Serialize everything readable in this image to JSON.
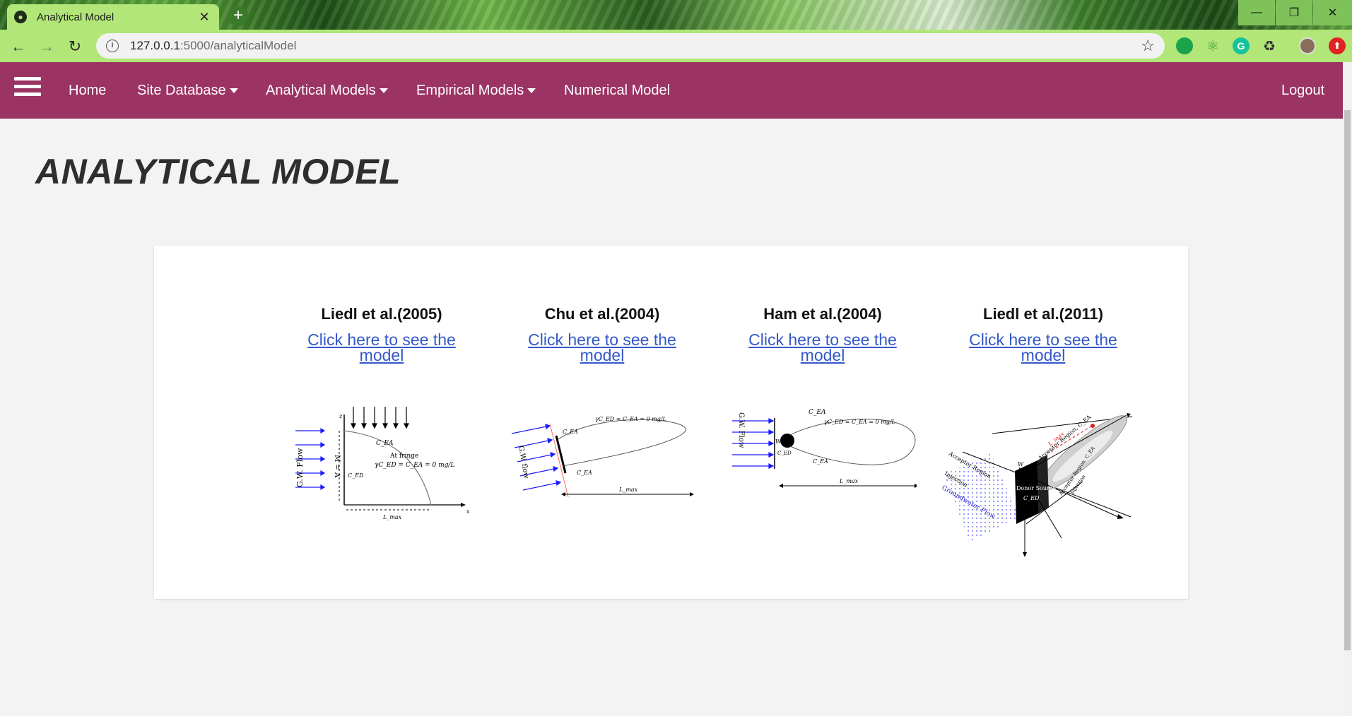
{
  "browser": {
    "tab_title": "Analytical Model",
    "url_host": "127.0.0.1",
    "url_rest": ":5000/analyticalModel"
  },
  "nav": {
    "home": "Home",
    "site_database": "Site Database",
    "analytical_models": "Analytical Models",
    "empirical_models": "Empirical Models",
    "numerical_model": "Numerical Model",
    "logout": "Logout"
  },
  "page": {
    "title": "ANALYTICAL MODEL"
  },
  "models": [
    {
      "name": "Liedl et al.(2005)",
      "link": "Click here to see the model",
      "figure": {
        "flow_label": "G.W. Flow",
        "w_label": "M = A",
        "c_ed": "C_ED",
        "c_ea": "C_EA",
        "fringe": "At fringe",
        "eq": "γC_ED = C_EA = 0 mg/L",
        "lmax": "L_max",
        "axis_z": "z",
        "axis_x": "x"
      }
    },
    {
      "name": "Chu et al.(2004)",
      "link": "Click here to see the model",
      "figure": {
        "flow_label": "G.W. flow",
        "c_ea": "C_EA",
        "eq": "γC_ED = C_EA = 0 mg/L",
        "lmax": "L_max"
      }
    },
    {
      "name": "Ham et al.(2004)",
      "link": "Click here to see the model",
      "figure": {
        "flow_label": "G.W. Flow",
        "c_ea": "C_EA",
        "c_ed": "C_ED",
        "eq": "γC_ED = C_EA = 0 mg/L",
        "lmax": "L_max",
        "w_label": "W"
      }
    },
    {
      "name": "Liedl et al.(2011)",
      "link": "Click here to see the model",
      "figure": {
        "flow_label": "Groundwater Flow",
        "donor": "Donor Source",
        "acceptor_up": "Acceptor Region, C_EA",
        "acceptor_left": "Acceptor Region",
        "injection": "Injection",
        "c_ed": "C_ED",
        "lmax": "L_max",
        "w_label": "W",
        "m_label": "M"
      }
    }
  ],
  "colors": {
    "nav_bg": "#9b3363",
    "link": "#3358c9",
    "tab_bg": "#b2e678"
  }
}
